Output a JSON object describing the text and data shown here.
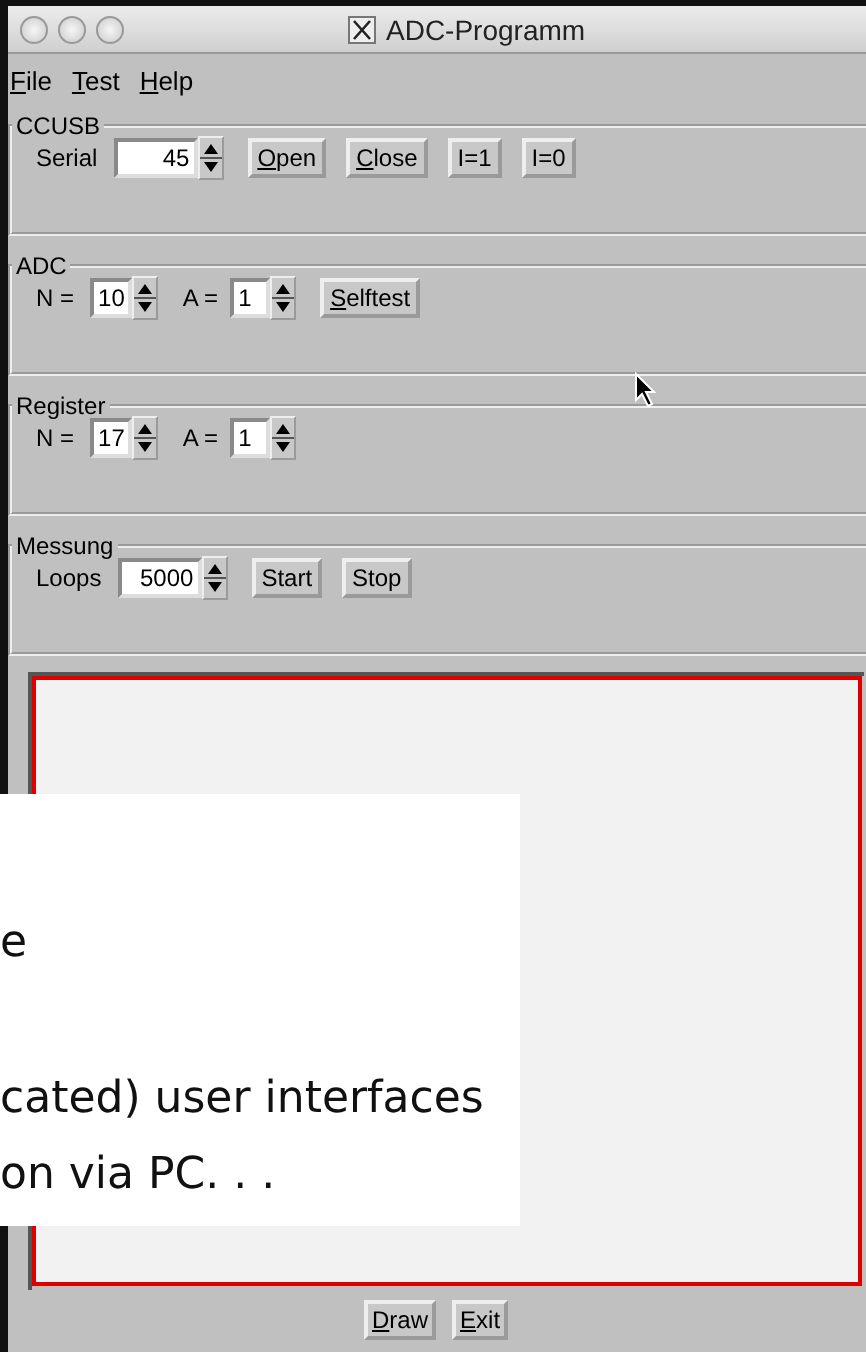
{
  "window": {
    "title": "ADC-Programm"
  },
  "menu": [
    {
      "label": "File",
      "mnemonic": true
    },
    {
      "label": "Test",
      "mnemonic": true
    },
    {
      "label": "Help",
      "mnemonic": true
    }
  ],
  "groups": [
    {
      "title": "CCUSB",
      "controls": [
        {
          "kind": "label",
          "text": "Serial"
        },
        {
          "kind": "field",
          "value": "45"
        },
        {
          "kind": "button",
          "label": "Open",
          "mnemonic": true
        },
        {
          "kind": "button",
          "label": "Close",
          "mnemonic": true
        },
        {
          "kind": "button",
          "label": "I=1",
          "mnemonic": false
        },
        {
          "kind": "button",
          "label": "I=0",
          "mnemonic": false
        }
      ]
    },
    {
      "title": "ADC",
      "controls": [
        {
          "kind": "label",
          "text": "N ="
        },
        {
          "kind": "spin",
          "value": "10"
        },
        {
          "kind": "label",
          "text": "A ="
        },
        {
          "kind": "spin",
          "value": "1"
        },
        {
          "kind": "button",
          "label": "Selftest",
          "mnemonic": true
        }
      ]
    },
    {
      "title": "Register",
      "controls": [
        {
          "kind": "label",
          "text": "N ="
        },
        {
          "kind": "spin",
          "value": "17"
        },
        {
          "kind": "label",
          "text": "A ="
        },
        {
          "kind": "spin",
          "value": "1"
        }
      ]
    },
    {
      "title": "Messung",
      "controls": [
        {
          "kind": "label",
          "text": "Loops"
        },
        {
          "kind": "field",
          "value": "5000"
        },
        {
          "kind": "button",
          "label": "Start",
          "mnemonic": false
        },
        {
          "kind": "button",
          "label": "Stop",
          "mnemonic": false
        }
      ]
    }
  ],
  "overlay": {
    "lines": [
      "e",
      "cated) user interfaces",
      "on via PC. . ."
    ]
  },
  "buttons": [
    {
      "label": "Draw",
      "mnemonic": true
    },
    {
      "label": "Exit",
      "mnemonic": true
    }
  ]
}
